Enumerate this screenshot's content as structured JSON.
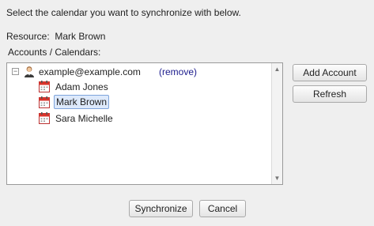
{
  "intro_text": "Select the calendar you want to synchronize with below.",
  "resource": {
    "label": "Resource:",
    "value": "Mark Brown"
  },
  "accounts_label": "Accounts / Calendars:",
  "tree": {
    "collapse_symbol": "−",
    "account": {
      "email": "example@example.com",
      "remove_label": "(remove)"
    },
    "calendars": [
      {
        "label": "Adam Jones",
        "selected": false
      },
      {
        "label": "Mark Brown",
        "selected": true
      },
      {
        "label": "Sara Michelle",
        "selected": false
      }
    ]
  },
  "buttons": {
    "add_account": "Add Account",
    "refresh": "Refresh",
    "synchronize": "Synchronize",
    "cancel": "Cancel"
  },
  "icons": {
    "account": "user-icon",
    "calendar": "calendar-icon"
  },
  "colors": {
    "calendar_red": "#d9342b",
    "link": "#1a1a8c",
    "selection": "#dde9fb"
  }
}
